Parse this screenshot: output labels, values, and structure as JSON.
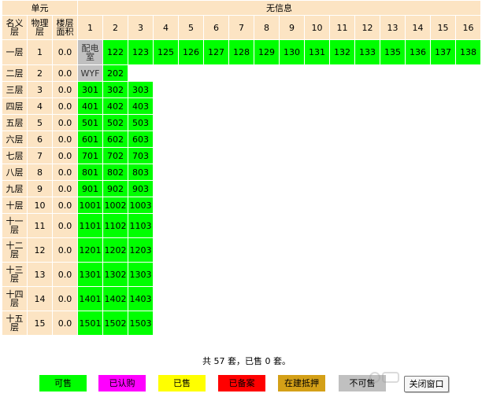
{
  "colors": {
    "header_bg": "#fce4c3",
    "available": "#00ff00",
    "subscribed": "#ff00ff",
    "sold": "#ffff00",
    "filed": "#ff0000",
    "mortgaged": "#d4a017",
    "unavailable": "#c0c0c0"
  },
  "header": {
    "unit_label": "单元",
    "unit_name": "无信息",
    "col_name_floor": "名义层",
    "col_physical_floor": "物理层",
    "col_floor_area": "楼层面积",
    "room_columns": [
      "1",
      "2",
      "3",
      "4",
      "5",
      "6",
      "7",
      "8",
      "9",
      "10",
      "11",
      "12",
      "13",
      "14",
      "15",
      "16"
    ]
  },
  "floors": [
    {
      "name": "一层",
      "physical": "1",
      "area": "0.0",
      "rooms": [
        {
          "label": "配电室",
          "status": "unavailable"
        },
        {
          "label": "122",
          "status": "available"
        },
        {
          "label": "123",
          "status": "available"
        },
        {
          "label": "125",
          "status": "available"
        },
        {
          "label": "126",
          "status": "available"
        },
        {
          "label": "127",
          "status": "available"
        },
        {
          "label": "128",
          "status": "available"
        },
        {
          "label": "129",
          "status": "available"
        },
        {
          "label": "130",
          "status": "available"
        },
        {
          "label": "131",
          "status": "available"
        },
        {
          "label": "132",
          "status": "available"
        },
        {
          "label": "133",
          "status": "available"
        },
        {
          "label": "135",
          "status": "available"
        },
        {
          "label": "136",
          "status": "available"
        },
        {
          "label": "137",
          "status": "available"
        },
        {
          "label": "138",
          "status": "available"
        }
      ]
    },
    {
      "name": "二层",
      "physical": "2",
      "area": "0.0",
      "rooms": [
        {
          "label": "WYF",
          "status": "unavailable"
        },
        {
          "label": "202",
          "status": "available"
        }
      ]
    },
    {
      "name": "三层",
      "physical": "3",
      "area": "0.0",
      "rooms": [
        {
          "label": "301",
          "status": "available"
        },
        {
          "label": "302",
          "status": "available"
        },
        {
          "label": "303",
          "status": "available"
        }
      ]
    },
    {
      "name": "四层",
      "physical": "4",
      "area": "0.0",
      "rooms": [
        {
          "label": "401",
          "status": "available"
        },
        {
          "label": "402",
          "status": "available"
        },
        {
          "label": "403",
          "status": "available"
        }
      ]
    },
    {
      "name": "五层",
      "physical": "5",
      "area": "0.0",
      "rooms": [
        {
          "label": "501",
          "status": "available"
        },
        {
          "label": "502",
          "status": "available"
        },
        {
          "label": "503",
          "status": "available"
        }
      ]
    },
    {
      "name": "六层",
      "physical": "6",
      "area": "0.0",
      "rooms": [
        {
          "label": "601",
          "status": "available"
        },
        {
          "label": "602",
          "status": "available"
        },
        {
          "label": "603",
          "status": "available"
        }
      ]
    },
    {
      "name": "七层",
      "physical": "7",
      "area": "0.0",
      "rooms": [
        {
          "label": "701",
          "status": "available"
        },
        {
          "label": "702",
          "status": "available"
        },
        {
          "label": "703",
          "status": "available"
        }
      ]
    },
    {
      "name": "八层",
      "physical": "8",
      "area": "0.0",
      "rooms": [
        {
          "label": "801",
          "status": "available"
        },
        {
          "label": "802",
          "status": "available"
        },
        {
          "label": "803",
          "status": "available"
        }
      ]
    },
    {
      "name": "九层",
      "physical": "9",
      "area": "0.0",
      "rooms": [
        {
          "label": "901",
          "status": "available"
        },
        {
          "label": "902",
          "status": "available"
        },
        {
          "label": "903",
          "status": "available"
        }
      ]
    },
    {
      "name": "十层",
      "physical": "10",
      "area": "0.0",
      "rooms": [
        {
          "label": "1001",
          "status": "available"
        },
        {
          "label": "1002",
          "status": "available"
        },
        {
          "label": "1003",
          "status": "available"
        }
      ]
    },
    {
      "name": "十一层",
      "physical": "11",
      "area": "0.0",
      "rooms": [
        {
          "label": "1101",
          "status": "available"
        },
        {
          "label": "1102",
          "status": "available"
        },
        {
          "label": "1103",
          "status": "available"
        }
      ]
    },
    {
      "name": "十二层",
      "physical": "12",
      "area": "0.0",
      "rooms": [
        {
          "label": "1201",
          "status": "available"
        },
        {
          "label": "1202",
          "status": "available"
        },
        {
          "label": "1203",
          "status": "available"
        }
      ]
    },
    {
      "name": "十三层",
      "physical": "13",
      "area": "0.0",
      "rooms": [
        {
          "label": "1301",
          "status": "available"
        },
        {
          "label": "1302",
          "status": "available"
        },
        {
          "label": "1303",
          "status": "available"
        }
      ]
    },
    {
      "name": "十四层",
      "physical": "14",
      "area": "0.0",
      "rooms": [
        {
          "label": "1401",
          "status": "available"
        },
        {
          "label": "1402",
          "status": "available"
        },
        {
          "label": "1403",
          "status": "available"
        }
      ]
    },
    {
      "name": "十五层",
      "physical": "15",
      "area": "0.0",
      "rooms": [
        {
          "label": "1501",
          "status": "available"
        },
        {
          "label": "1502",
          "status": "available"
        },
        {
          "label": "1503",
          "status": "available"
        }
      ]
    }
  ],
  "summary": "共 57 套，已售 0 套。",
  "legend": [
    {
      "label": "可售",
      "color": "#00ff00"
    },
    {
      "label": "已认购",
      "color": "#ff00ff"
    },
    {
      "label": "已售",
      "color": "#ffff00"
    },
    {
      "label": "已备案",
      "color": "#ff0000"
    },
    {
      "label": "在建抵押",
      "color": "#d4a017"
    },
    {
      "label": "不可售",
      "color": "#c0c0c0"
    }
  ],
  "close_button": "关闭窗口"
}
